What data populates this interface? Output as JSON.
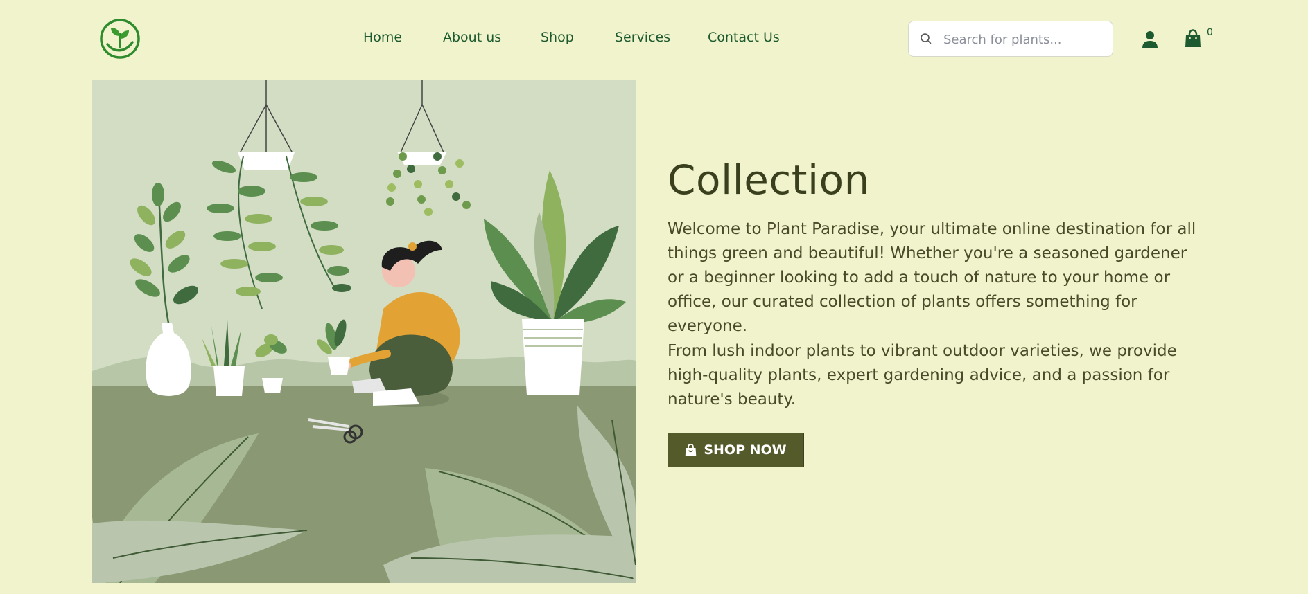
{
  "header": {
    "logo_icon": "plant-in-hand-logo",
    "nav": [
      {
        "label": "Home"
      },
      {
        "label": "About us"
      },
      {
        "label": "Shop"
      },
      {
        "label": "Services"
      },
      {
        "label": "Contact Us"
      }
    ],
    "search": {
      "placeholder": "Search for plants...",
      "value": "",
      "icon": "search-icon"
    },
    "user_icon": "user-icon",
    "cart": {
      "icon": "shopping-bag-icon",
      "count": "0"
    }
  },
  "hero": {
    "image": "illustration-woman-planting-houseplants",
    "title": "Collection",
    "paragraph1": "Welcome to Plant Paradise, your ultimate online destination for all things green and beautiful! Whether you're a seasoned gardener or a beginner looking to add a touch of nature to your home or office, our curated collection of plants offers something for everyone.",
    "paragraph2": "From lush indoor plants to vibrant outdoor varieties, we provide high-quality plants, expert gardening advice, and a passion for nature's beauty.",
    "cta": {
      "label": "SHOP NOW",
      "icon": "shopping-bag-icon"
    }
  },
  "colors": {
    "background": "#f1f3cc",
    "nav_text": "#1d5a2f",
    "title_text": "#3a3f1d",
    "button_bg": "#545a2a",
    "logo_green": "#2e8b2e"
  }
}
